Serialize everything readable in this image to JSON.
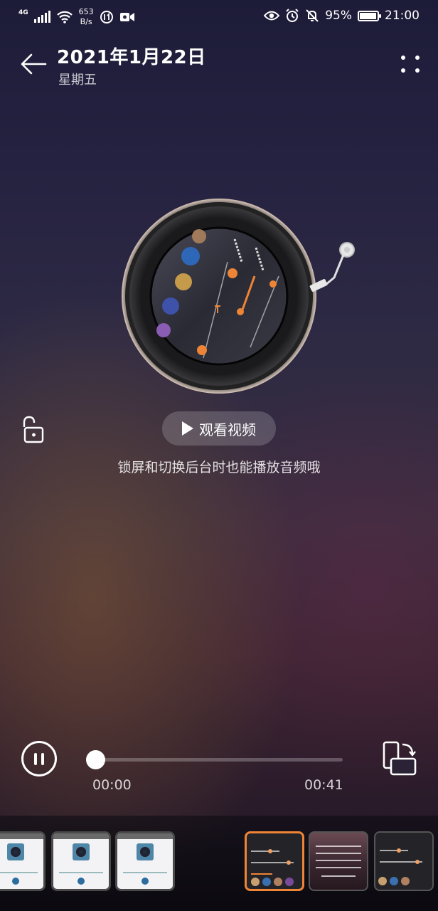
{
  "status_bar": {
    "network": "4G",
    "speed_value": "653",
    "speed_unit": "B/s",
    "battery": "95%",
    "battery_level": 0.95,
    "time": "21:00"
  },
  "header": {
    "date": "2021年1月22日",
    "weekday": "星期五"
  },
  "main": {
    "watch_video_label": "观看视频",
    "hint_text": "锁屏和切换后台时也能播放音频哦"
  },
  "player": {
    "current_time": "00:00",
    "total_time": "00:41",
    "progress": 0.0
  },
  "thumbnails": [
    {
      "style": "light",
      "selected": false
    },
    {
      "style": "light",
      "selected": false
    },
    {
      "style": "light",
      "selected": false
    },
    {
      "style": "dark",
      "selected": true
    },
    {
      "style": "photo",
      "selected": false
    },
    {
      "style": "dark",
      "selected": false
    }
  ],
  "colors": {
    "accent": "#ee8436",
    "record_inner": "#3a6fb0"
  }
}
